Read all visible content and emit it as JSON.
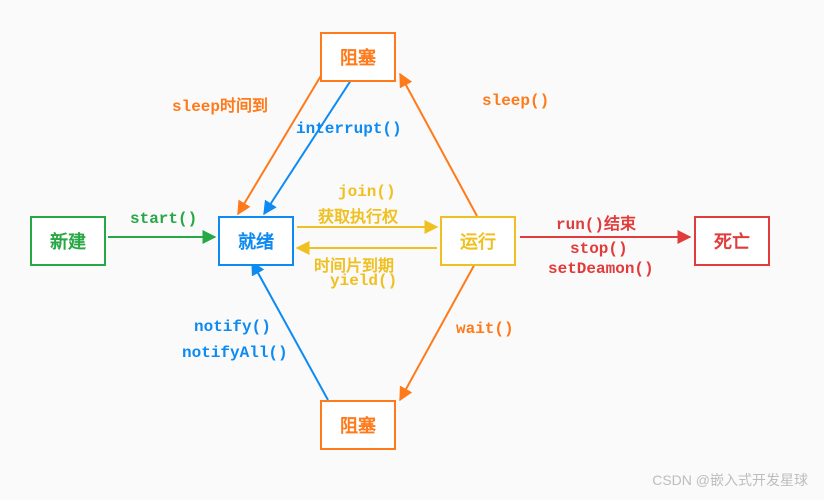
{
  "nodes": {
    "new": {
      "label": "新建"
    },
    "ready": {
      "label": "就绪"
    },
    "running": {
      "label": "运行"
    },
    "blocked_top": {
      "label": "阻塞"
    },
    "blocked_bottom": {
      "label": "阻塞"
    },
    "dead": {
      "label": "死亡"
    }
  },
  "edges": {
    "start": "start()",
    "sleep_done": "sleep时间到",
    "interrupt": "interrupt()",
    "join": "join()",
    "get_exec": "获取执行权",
    "timeslice": "时间片到期",
    "yield": "yield()",
    "sleep": "sleep()",
    "wait": "wait()",
    "notify": "notify()",
    "notify_all": "notifyAll()",
    "run_end": "run()结束",
    "stop": "stop()",
    "set_daemon": "setDeamon()"
  },
  "colors": {
    "green": "#28a745",
    "blue": "#0d8bf2",
    "orange": "#ff7a1a",
    "yellow": "#f0c020",
    "red": "#e23b3b"
  },
  "watermark": "CSDN @嵌入式开发星球"
}
